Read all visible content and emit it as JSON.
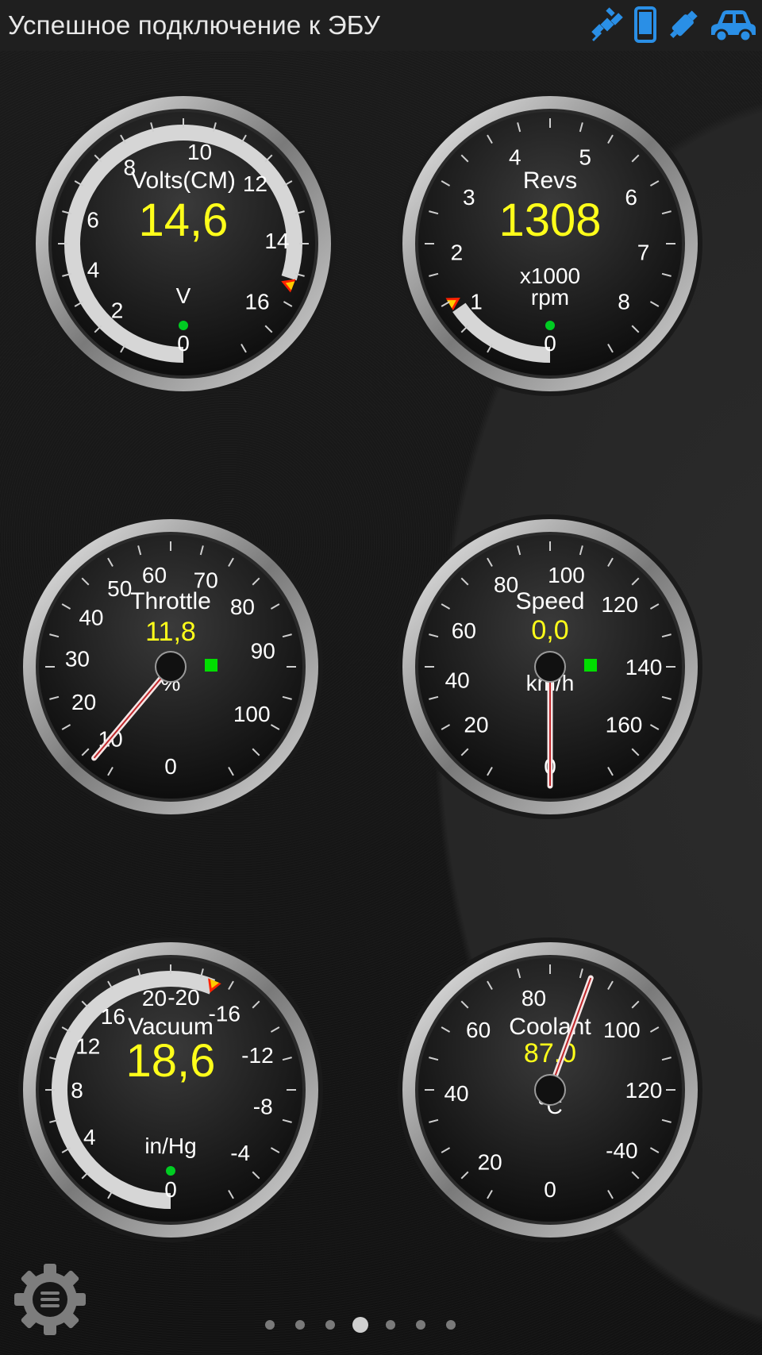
{
  "status_bar": {
    "title": "Успешное подключение к ЭБУ",
    "icons": [
      "satellite-icon",
      "phone-icon",
      "obd-adapter-icon",
      "car-icon"
    ],
    "icon_color": "#2a8fe6"
  },
  "gauges": [
    {
      "name": "Volts(CM)",
      "value_text": "14,6",
      "unit": "V",
      "center_label": "0",
      "value": 14.6,
      "min": 0,
      "max": 18,
      "ticks": [
        "2",
        "4",
        "6",
        "8",
        "10",
        "12",
        "14",
        "16"
      ],
      "bar": true,
      "status_dot": "#00cc22"
    },
    {
      "name": "Revs",
      "value_text": "1308",
      "unit": "x1000",
      "unit2": "rpm",
      "center_label": "0",
      "value": 1.308,
      "min": 0,
      "max": 9,
      "ticks": [
        "1",
        "2",
        "3",
        "4",
        "5",
        "6",
        "7",
        "8"
      ],
      "bar": true,
      "status_dot": "#00cc22"
    },
    {
      "name": "Throttle",
      "value_text": "11,8",
      "unit": "%",
      "center_label": "0",
      "value": 11.8,
      "min": 0,
      "max": 110,
      "ticks": [
        "10",
        "20",
        "30",
        "40",
        "50",
        "60",
        "70",
        "80",
        "90",
        "100"
      ],
      "bar": false,
      "status_dot": "#00dd00"
    },
    {
      "name": "Speed",
      "value_text": "0,0",
      "unit": "km/h",
      "center_label": "0",
      "value": 0,
      "min": 0,
      "max": 180,
      "ticks": [
        "20",
        "40",
        "60",
        "80",
        "100",
        "120",
        "140",
        "160"
      ],
      "bar": false,
      "status_dot": "#00dd00"
    },
    {
      "name": "Vacuum",
      "value_text": "18,6",
      "unit": "in/Hg",
      "center_label": "0",
      "value": 18.6,
      "min": 0,
      "max": 24,
      "ticks": [
        "-4",
        "-8",
        "-12",
        "-16",
        "-20",
        "20",
        "16",
        "12",
        "8",
        "4"
      ],
      "bar": true,
      "status_dot": "#00cc22"
    },
    {
      "name": "Coolant",
      "value_text": "87,0",
      "unit": "°C",
      "center_label": "0",
      "value": 87,
      "min": -40,
      "max": 140,
      "ticks": [
        "20",
        "40",
        "60",
        "80",
        "100",
        "120",
        "-40"
      ],
      "bar": false,
      "status_dot": null
    }
  ],
  "pager": {
    "count": 7,
    "active_index": 3
  },
  "settings": {
    "icon": "gear-menu-icon"
  }
}
